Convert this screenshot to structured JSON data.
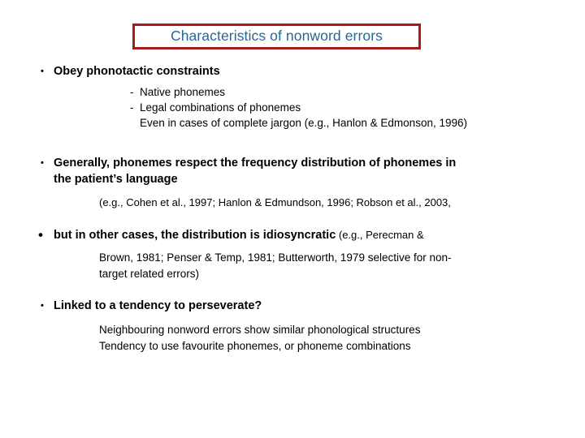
{
  "slide": {
    "title": "Characteristics of nonword errors",
    "title_border_color": "#A31B1B",
    "title_text_color": "#1F6A94",
    "background_color": "#FFFFFF",
    "text_color": "#000000"
  },
  "bullets": {
    "marker_dot": "•",
    "marker_dash": "-"
  },
  "sections": [
    {
      "heading": "Obey phonotactic constraints",
      "sub_items": [
        "Native phonemes",
        "Legal combinations of phonemes"
      ],
      "note": "Even in cases of complete jargon (e.g., Hanlon & Edmonson, 1996)"
    },
    {
      "heading_line1": "Generally, phonemes respect the frequency distribution of phonemes in",
      "heading_line2": "the patient’s language",
      "citation": "(e.g., Cohen et al., 1997; Hanlon & Edmundson, 1996; Robson et al.,  2003,"
    },
    {
      "heading_bold": "but in other cases, the distribution is idiosyncratic",
      "heading_tail": " (e.g., Perecman &",
      "detail_line1": "Brown, 1981; Penser & Temp, 1981; Butterworth, 1979  selective for non-",
      "detail_line2": "target related errors)"
    },
    {
      "heading": "Linked to a tendency to perseverate?",
      "detail_line1": "Neighbouring nonword errors show similar phonological structures",
      "detail_line2": "Tendency to use favourite phonemes, or phoneme combinations"
    }
  ]
}
